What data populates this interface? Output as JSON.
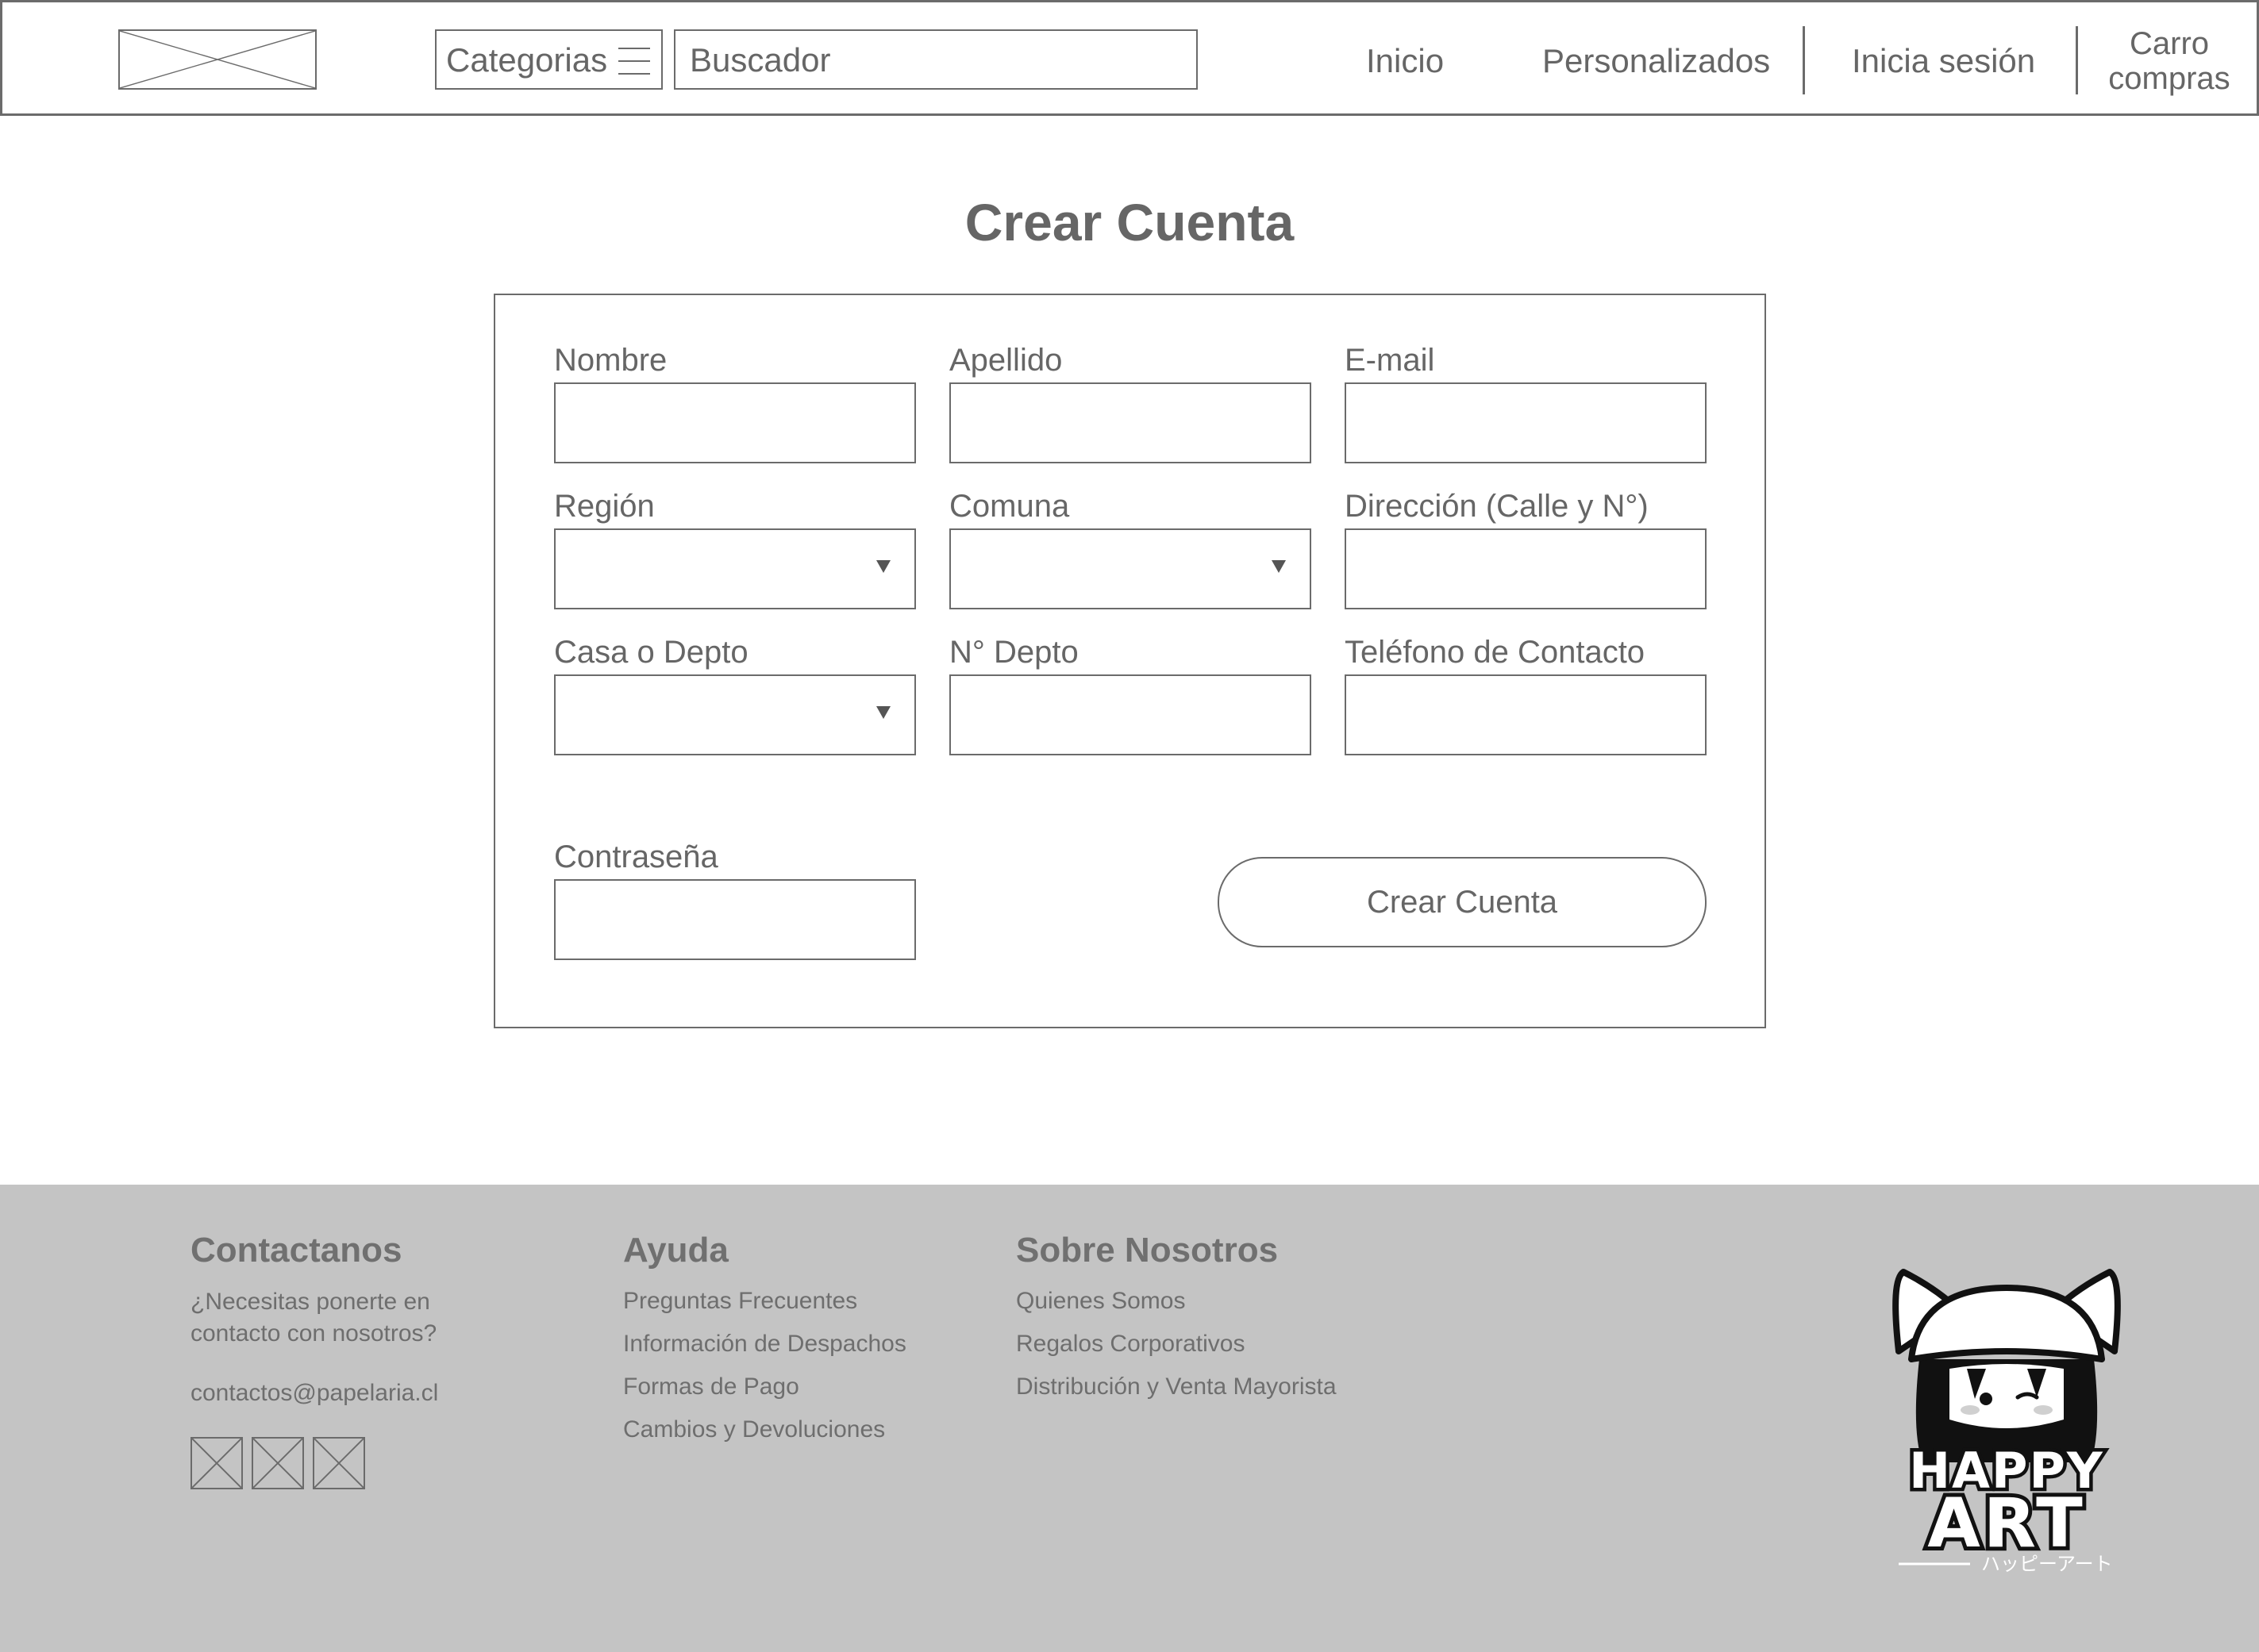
{
  "header": {
    "categories_label": "Categorias",
    "search_placeholder": "Buscador",
    "nav": {
      "home": "Inicio",
      "custom": "Personalizados",
      "login": "Inicia sesión",
      "cart_line1": "Carro",
      "cart_line2": "compras"
    }
  },
  "form": {
    "title": "Crear Cuenta",
    "fields": {
      "nombre": "Nombre",
      "apellido": "Apellido",
      "email": "E-mail",
      "region": "Región",
      "comuna": "Comuna",
      "direccion": "Dirección (Calle y N°)",
      "casa_depto": "Casa o Depto",
      "n_depto": "N° Depto",
      "telefono": "Teléfono de Contacto",
      "password": "Contraseña"
    },
    "submit_label": "Crear Cuenta"
  },
  "footer": {
    "contact": {
      "heading": "Contactanos",
      "text_line1": "¿Necesitas ponerte en",
      "text_line2": "contacto con nosotros?",
      "email": "contactos@papelaria.cl"
    },
    "help": {
      "heading": "Ayuda",
      "links": [
        "Preguntas Frecuentes",
        "Información de Despachos",
        "Formas de Pago",
        "Cambios y Devoluciones"
      ]
    },
    "about": {
      "heading": "Sobre Nosotros",
      "links": [
        "Quienes Somos",
        "Regalos Corporativos",
        "Distribución y Venta Mayorista"
      ]
    },
    "brand": {
      "line1": "HAPPY",
      "line2": "ART",
      "subtitle": "ハッピーアート"
    }
  },
  "colors": {
    "wire": "#6b6b6b",
    "text": "#666666",
    "footer_bg": "#c4c4c4"
  }
}
